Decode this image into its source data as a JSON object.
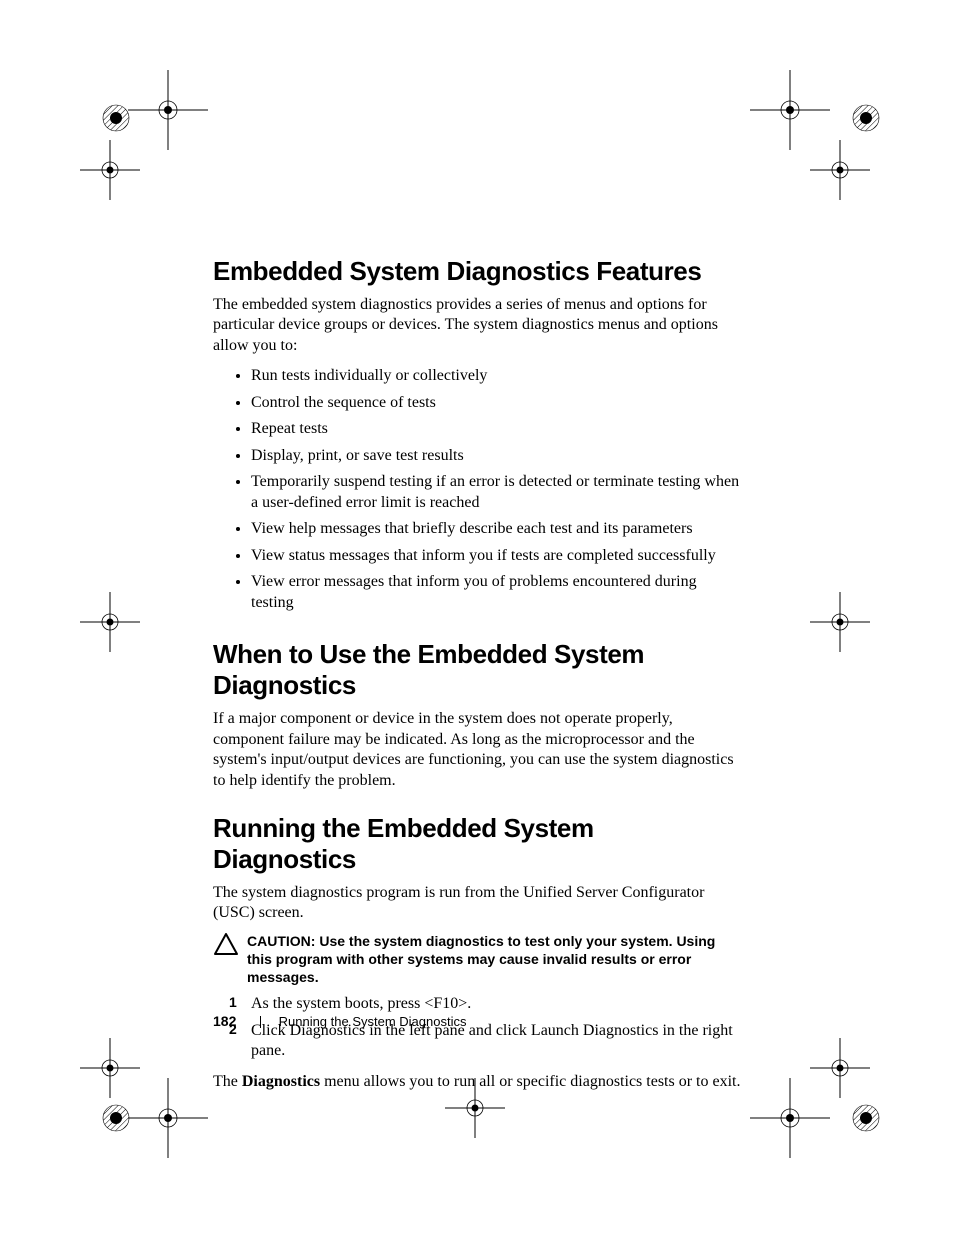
{
  "headings": {
    "h1": "Embedded System Diagnostics Features",
    "h2": "When to Use the Embedded System Diagnostics",
    "h3": "Running the Embedded System Diagnostics"
  },
  "intro1": "The embedded system diagnostics provides a series of menus and options for particular device groups or devices. The system diagnostics menus and options allow you to:",
  "bullets": [
    "Run tests individually or collectively",
    "Control the sequence of tests",
    "Repeat tests",
    "Display, print, or save test results",
    "Temporarily suspend testing if an error is detected or terminate testing when a user-defined error limit is reached",
    "View help messages that briefly describe each test and its parameters",
    "View status messages that inform you if tests are completed successfully",
    "View error messages that inform you of problems encountered during testing"
  ],
  "when_body": "If a major component or device in the system does not operate properly, component failure may be indicated. As long as the microprocessor and the system's input/output devices are functioning, you can use the system diagnostics to help identify the problem.",
  "running_body": "The system diagnostics program is run from the Unified Server Configurator (USC) screen.",
  "caution": {
    "label": "CAUTION: ",
    "text": "Use the system diagnostics to test only your system. Using this program with other systems may cause invalid results or error messages."
  },
  "steps": [
    "As the system boots, press <F10>.",
    "Click Diagnostics in the left pane and click Launch Diagnostics in the right pane."
  ],
  "closing_pre": "The ",
  "closing_bold": "Diagnostics",
  "closing_post": " menu allows you to run all or specific diagnostics tests or to exit.",
  "footer": {
    "page_number": "182",
    "section": "Running the System Diagnostics"
  }
}
